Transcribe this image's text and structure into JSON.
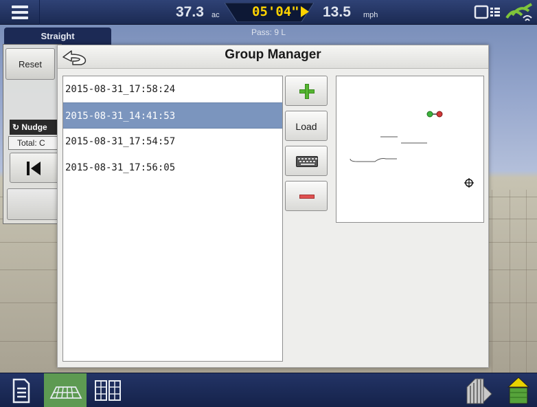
{
  "topbar": {
    "area_value": "37.3",
    "area_unit": "ac",
    "timer": "05'04\"",
    "speed_value": "13.5",
    "speed_unit": "mph",
    "icons": [
      "menu-icon",
      "display-device-icon",
      "gps-signal-icon",
      "play-icon"
    ]
  },
  "subheader": {
    "mode_tab": "Straight",
    "pass_label": "Pass: 9 L"
  },
  "left_panel": {
    "reset_label": "Reset",
    "nudge_label": "Nudge",
    "total_label": "Total: C"
  },
  "dialog": {
    "title": "Group Manager",
    "groups": [
      {
        "name": "2015-08-31_17:58:24",
        "selected": false
      },
      {
        "name": "2015-08-31_14:41:53",
        "selected": true
      },
      {
        "name": "2015-08-31_17:54:57",
        "selected": false
      },
      {
        "name": "2015-08-31_17:56:05",
        "selected": false
      }
    ],
    "buttons": {
      "add": "add-icon",
      "load": "Load",
      "keyboard": "keyboard-icon",
      "delete": "minus-icon"
    },
    "colors": {
      "selected_row": "#7b95be",
      "add_green": "#55b531",
      "delete_red": "#e05252"
    }
  },
  "bottombar": {
    "icons": [
      "document-icon",
      "field-map-icon",
      "split-view-icon",
      "planter-icon",
      "grain-bin-icon"
    ],
    "active": "field-map-icon",
    "active_color": "#5d9a52"
  }
}
